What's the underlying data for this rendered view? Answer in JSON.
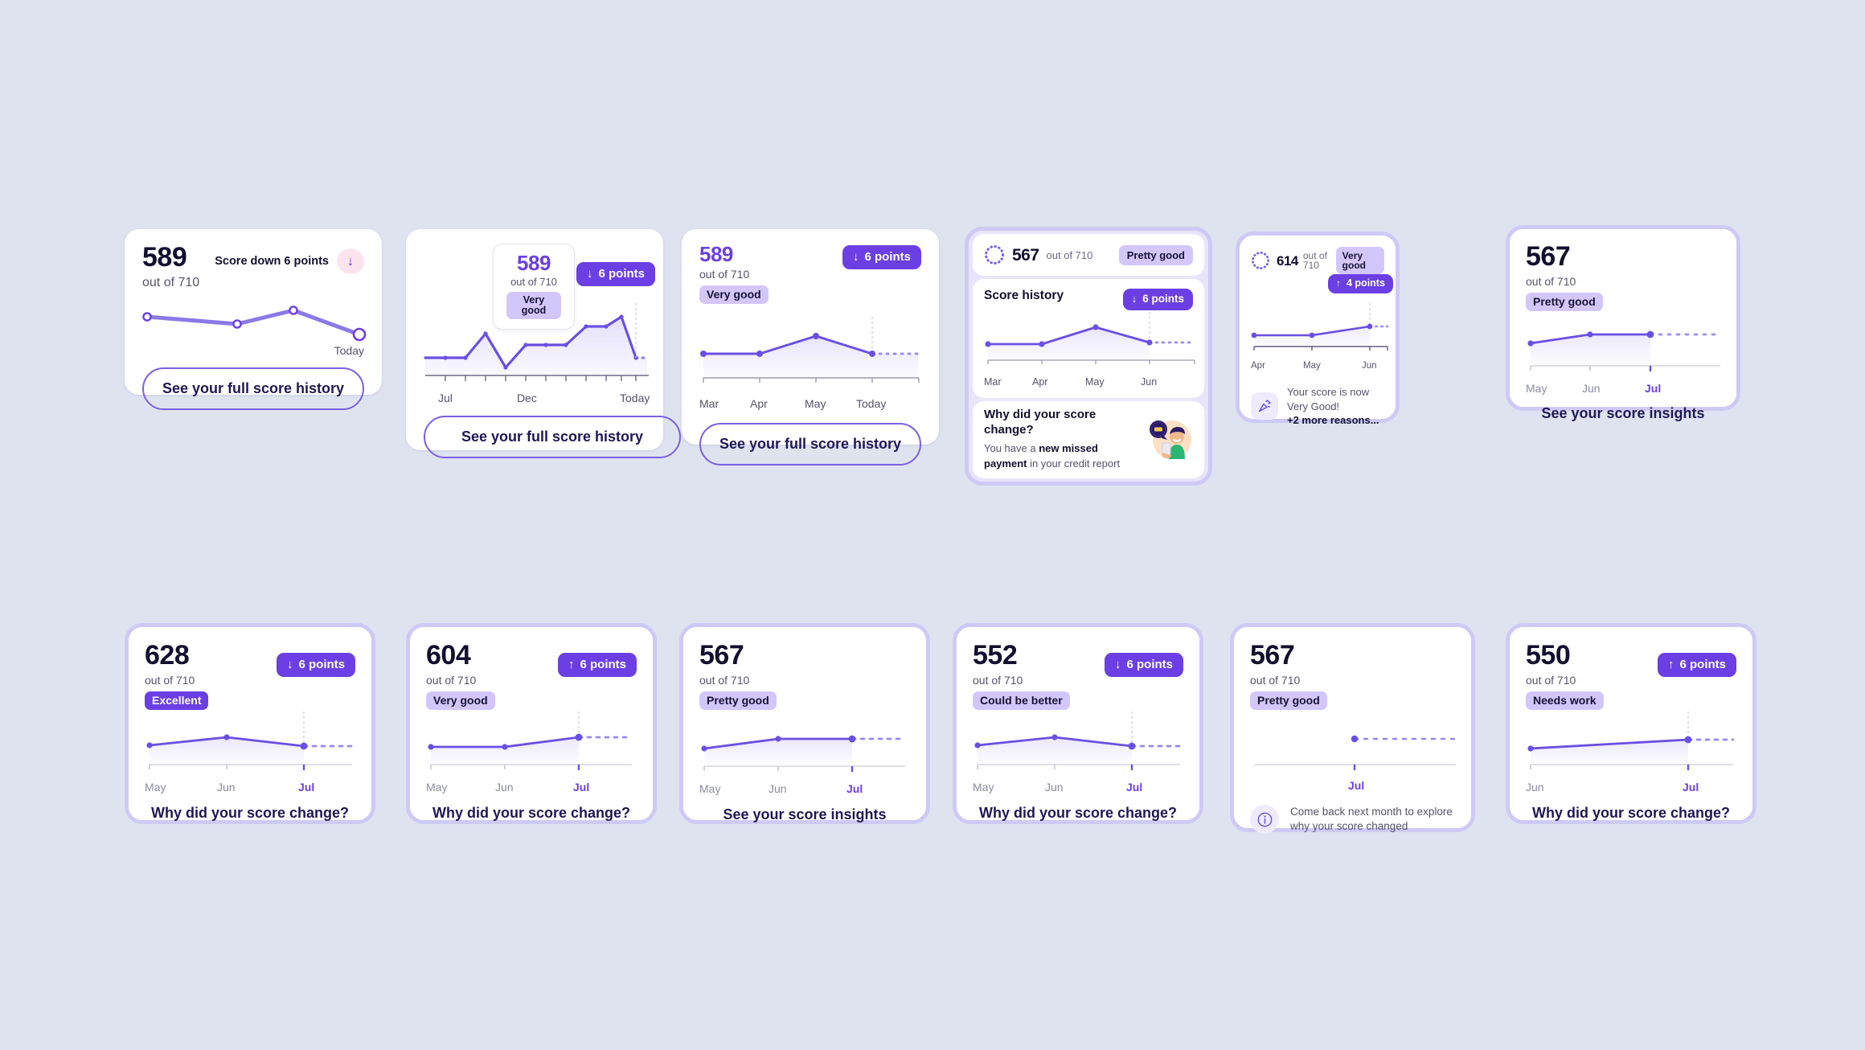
{
  "page": {
    "background": "#dfe3f0",
    "accent": "#6b3fe3",
    "accent_light": "#d3c6fb",
    "ink": "#120f2e"
  },
  "labels": {
    "out_of_710": "out of 710",
    "see_full_history": "See your full score history",
    "see_insights": "See your score insights",
    "why_change": "Why did your score change?",
    "score_history": "Score history",
    "score_down_6": "Score down 6 points",
    "down_6_points": "6 points",
    "up_6_points": "6 points",
    "up_4_points": "4 points",
    "arrow_down": "↓",
    "arrow_up": "↑"
  },
  "cards": [
    {
      "id": "card-score-summary",
      "score": "589",
      "out_of": "out of 710",
      "trend_text": "Score down 6 points",
      "trend_dir": "down",
      "cta": "See your full score history",
      "chart_data": {
        "type": "line",
        "title": "Score trend",
        "x": [
          "",
          "",
          "",
          "Today"
        ],
        "categories": [
          "",
          "",
          "",
          "Today"
        ],
        "values": [
          589,
          583,
          595,
          575
        ],
        "tick_labels": [
          "Today"
        ],
        "ylim": [
          560,
          610
        ],
        "grid": false,
        "legend": "none",
        "markers": "open-circle"
      }
    },
    {
      "id": "card-full-history-tooltip",
      "tooltip": {
        "score": "589",
        "out_of": "out of 710",
        "badge": "Very good"
      },
      "pill": {
        "arrow": "↓",
        "text": "6 points"
      },
      "cta": "See your full score history",
      "chart_data": {
        "type": "area",
        "title": "Full score history",
        "categories": [
          "",
          "Jul",
          "",
          "",
          "",
          "Dec",
          "",
          "",
          "",
          "",
          "Today",
          "",
          ""
        ],
        "tick_labels": [
          "Jul",
          "Dec",
          "Today"
        ],
        "values": [
          560,
          560,
          560,
          592,
          548,
          578,
          578,
          578,
          604,
          604,
          612,
          564,
          564
        ],
        "projected_from_index": 10,
        "ylim": [
          530,
          630
        ],
        "grid": false,
        "legend": "none"
      }
    },
    {
      "id": "card-history-3mo",
      "score": "589",
      "out_of": "out of 710",
      "badge": "Very good",
      "pill": {
        "arrow": "↓",
        "text": "6 points"
      },
      "cta": "See your full score history",
      "chart_data": {
        "type": "area",
        "title": "Score history",
        "categories": [
          "Mar",
          "Apr",
          "May",
          "Today"
        ],
        "tick_labels": [
          "Mar",
          "Apr",
          "May",
          "Today"
        ],
        "values": [
          589,
          589,
          612,
          583
        ],
        "projected_from_index": 3,
        "ylim": [
          560,
          630
        ],
        "grid": false,
        "legend": "none"
      }
    },
    {
      "id": "card-sectioned-why",
      "score": "567",
      "out_of": "out of 710",
      "badge": "Pretty good",
      "section_title": "Score history",
      "pill": {
        "arrow": "↓",
        "text": "6 points"
      },
      "why_title": "Why did your score change?",
      "why_body_pre": "You have a ",
      "why_body_bold": "new missed payment",
      "why_body_post": " in your credit report",
      "gauge": "dotted-ring",
      "illustration": "person-with-phone",
      "chart_data": {
        "type": "area",
        "title": "Score history",
        "categories": [
          "Mar",
          "Apr",
          "May",
          "Jun"
        ],
        "tick_labels": [
          "Mar",
          "Apr",
          "May",
          "Jun"
        ],
        "values": [
          567,
          567,
          590,
          573
        ],
        "projected_from_index": 3,
        "ylim": [
          545,
          605
        ],
        "grid": false,
        "legend": "none"
      }
    },
    {
      "id": "card-celebration",
      "score": "614",
      "out_of": "out of 710",
      "badge": "Very good",
      "pill": {
        "arrow": "↑",
        "text": "4 points"
      },
      "note_line1": "Your score is now Very Good!",
      "note_line2": "+2 more reasons...",
      "note_icon": "party-popper-icon",
      "gauge": "dotted-ring",
      "chart_data": {
        "type": "area",
        "title": "Score history",
        "categories": [
          "Apr",
          "May",
          "Jun"
        ],
        "tick_labels": [
          "Apr",
          "May",
          "Jun"
        ],
        "values": [
          606,
          606,
          614
        ],
        "projected_from_index": 2,
        "ylim": [
          590,
          625
        ],
        "grid": false,
        "legend": "none"
      }
    },
    {
      "id": "card-insights-567",
      "score": "567",
      "out_of": "out of 710",
      "badge": "Pretty good",
      "cta": "See your score insights",
      "chart_data": {
        "type": "area",
        "title": "Score history",
        "categories": [
          "May",
          "Jun",
          "Jul"
        ],
        "tick_labels": [
          "May",
          "Jun",
          "Jul"
        ],
        "values": [
          556,
          567,
          567
        ],
        "projected_from_index": 2,
        "active_tick": "Jul",
        "ylim": [
          540,
          580
        ],
        "grid": false,
        "legend": "none"
      }
    },
    {
      "id": "card-628-excellent",
      "score": "628",
      "out_of": "out of 710",
      "badge": "Excellent",
      "badge_style": "solid",
      "pill": {
        "arrow": "↓",
        "text": "6 points"
      },
      "cta": "Why did your score change?",
      "chart_data": {
        "type": "area",
        "title": "Score history",
        "categories": [
          "May",
          "Jun",
          "Jul"
        ],
        "tick_labels": [
          "May",
          "Jun",
          "Jul"
        ],
        "values": [
          628,
          641,
          628
        ],
        "projected_from_index": 2,
        "active_tick": "Jul",
        "ylim": [
          600,
          660
        ],
        "grid": false,
        "legend": "none"
      }
    },
    {
      "id": "card-604-verygood",
      "score": "604",
      "out_of": "out of 710",
      "badge": "Very good",
      "pill": {
        "arrow": "↑",
        "text": "6 points"
      },
      "cta": "Why did your score change?",
      "chart_data": {
        "type": "area",
        "title": "Score history",
        "categories": [
          "May",
          "Jun",
          "Jul"
        ],
        "tick_labels": [
          "May",
          "Jun",
          "Jul"
        ],
        "values": [
          598,
          598,
          604
        ],
        "projected_from_index": 2,
        "active_tick": "Jul",
        "ylim": [
          580,
          615
        ],
        "grid": false,
        "legend": "none"
      }
    },
    {
      "id": "card-567-insights",
      "score": "567",
      "out_of": "out of 710",
      "badge": "Pretty good",
      "cta": "See your score insights",
      "chart_data": {
        "type": "area",
        "title": "Score history",
        "categories": [
          "May",
          "Jun",
          "Jul"
        ],
        "tick_labels": [
          "May",
          "Jun",
          "Jul"
        ],
        "values": [
          556,
          567,
          567
        ],
        "projected_from_index": 2,
        "active_tick": "Jul",
        "ylim": [
          540,
          580
        ],
        "grid": false,
        "legend": "none"
      }
    },
    {
      "id": "card-552-couldbebetter",
      "score": "552",
      "out_of": "out of 710",
      "badge": "Could be better",
      "pill": {
        "arrow": "↓",
        "text": "6 points"
      },
      "cta": "Why did your score change?",
      "chart_data": {
        "type": "area",
        "title": "Score history",
        "categories": [
          "May",
          "Jun",
          "Jul"
        ],
        "tick_labels": [
          "May",
          "Jun",
          "Jul"
        ],
        "values": [
          552,
          565,
          552
        ],
        "projected_from_index": 2,
        "active_tick": "Jul",
        "ylim": [
          525,
          585
        ],
        "grid": false,
        "legend": "none"
      }
    },
    {
      "id": "card-567-comeback",
      "score": "567",
      "out_of": "out of 710",
      "badge": "Pretty good",
      "note_line1": "Come back next month to explore",
      "note_line2": "why your score changed",
      "note_icon": "info-icon",
      "chart_data": {
        "type": "line",
        "title": "Score history",
        "categories": [
          "Jul"
        ],
        "tick_labels": [
          "Jul"
        ],
        "values": [
          567
        ],
        "projected_from_index": 0,
        "active_tick": "Jul",
        "ylim": [
          540,
          580
        ],
        "grid": false,
        "legend": "none"
      }
    },
    {
      "id": "card-550-needswork",
      "score": "550",
      "out_of": "out of 710",
      "badge": "Needs work",
      "pill": {
        "arrow": "↑",
        "text": "6 points"
      },
      "cta": "Why did your score change?",
      "chart_data": {
        "type": "area",
        "title": "Score history",
        "categories": [
          "Jun",
          "Jul"
        ],
        "tick_labels": [
          "Jun",
          "Jul"
        ],
        "values": [
          544,
          550
        ],
        "projected_from_index": 1,
        "active_tick": "Jul",
        "ylim": [
          530,
          565
        ],
        "grid": false,
        "legend": "none"
      }
    }
  ]
}
